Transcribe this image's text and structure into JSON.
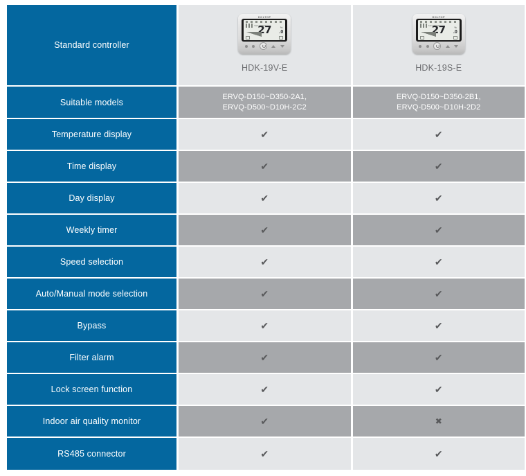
{
  "table": {
    "colors": {
      "label_blue": "#04679f",
      "shade_light": "#e4e6e8",
      "shade_dark": "#a6a8ab",
      "mark_gray": "#58595b",
      "model_text": "#6d6e71"
    },
    "header": {
      "label": "Standard controller",
      "columns": [
        {
          "model": "HDK-19V-E",
          "device": {
            "brand": "HOLTOP",
            "display_temp": "27",
            "display_decimal": ".0",
            "display_unit_top": "%",
            "display_unit_bottom": "C",
            "set_label": "SET TEMP"
          }
        },
        {
          "model": "HDK-19S-E",
          "device": {
            "brand": "HOLTOP",
            "display_temp": "27",
            "display_decimal": ".0",
            "display_unit_top": "%",
            "display_unit_bottom": "C",
            "set_label": "SET TEMP"
          }
        }
      ]
    },
    "models_row": {
      "label": "Suitable models",
      "values": [
        "ERVQ-D150~D350-2A1,\nERVQ-D500~D10H-2C2",
        "ERVQ-D150~D350-2B1,\nERVQ-D500~D10H-2D2"
      ]
    },
    "features": [
      {
        "label": "Temperature display",
        "shade": "light",
        "marks": [
          "check",
          "check"
        ]
      },
      {
        "label": "Time display",
        "shade": "dark",
        "marks": [
          "check",
          "check"
        ]
      },
      {
        "label": "Day display",
        "shade": "light",
        "marks": [
          "check",
          "check"
        ]
      },
      {
        "label": "Weekly timer",
        "shade": "dark",
        "marks": [
          "check",
          "check"
        ]
      },
      {
        "label": "Speed selection",
        "shade": "light",
        "marks": [
          "check",
          "check"
        ]
      },
      {
        "label": "Auto/Manual mode selection",
        "shade": "dark",
        "marks": [
          "check",
          "check"
        ]
      },
      {
        "label": "Bypass",
        "shade": "light",
        "marks": [
          "check",
          "check"
        ]
      },
      {
        "label": "Filter alarm",
        "shade": "dark",
        "marks": [
          "check",
          "check"
        ]
      },
      {
        "label": "Lock screen function",
        "shade": "light",
        "marks": [
          "check",
          "check"
        ]
      },
      {
        "label": "Indoor air quality monitor",
        "shade": "dark",
        "marks": [
          "check",
          "cross"
        ]
      },
      {
        "label": "RS485 connector",
        "shade": "light",
        "marks": [
          "check",
          "check"
        ]
      }
    ],
    "glyphs": {
      "check": "✔",
      "cross": "✖"
    }
  }
}
